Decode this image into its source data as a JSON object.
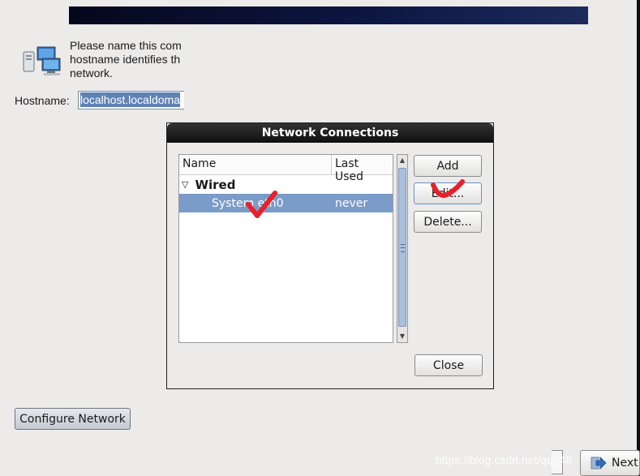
{
  "intro": {
    "line1": "Please name this com",
    "line2": "hostname identifies th",
    "line3": "network."
  },
  "hostname": {
    "label": "Hostname:",
    "value": "localhost.localdoma"
  },
  "dialog": {
    "title": "Network Connections",
    "columns": {
      "name": "Name",
      "last_used": "Last Used"
    },
    "group": "Wired",
    "connection": {
      "name": "System eth0",
      "last_used": "never"
    },
    "buttons": {
      "add": "Add",
      "edit": "Edit...",
      "delete": "Delete...",
      "close": "Close"
    }
  },
  "footer": {
    "configure_network": "Configure Network",
    "next": "Next",
    "watermark": "https://blog.csdn.net/qq_48"
  },
  "icons": {
    "network": "network-computers-icon",
    "next": "next-arrow-icon",
    "check": "red-checkmark-annotation"
  },
  "colors": {
    "banner": "#0c1540",
    "selection": "#7b9bc8",
    "annotation": "#e8202a"
  }
}
